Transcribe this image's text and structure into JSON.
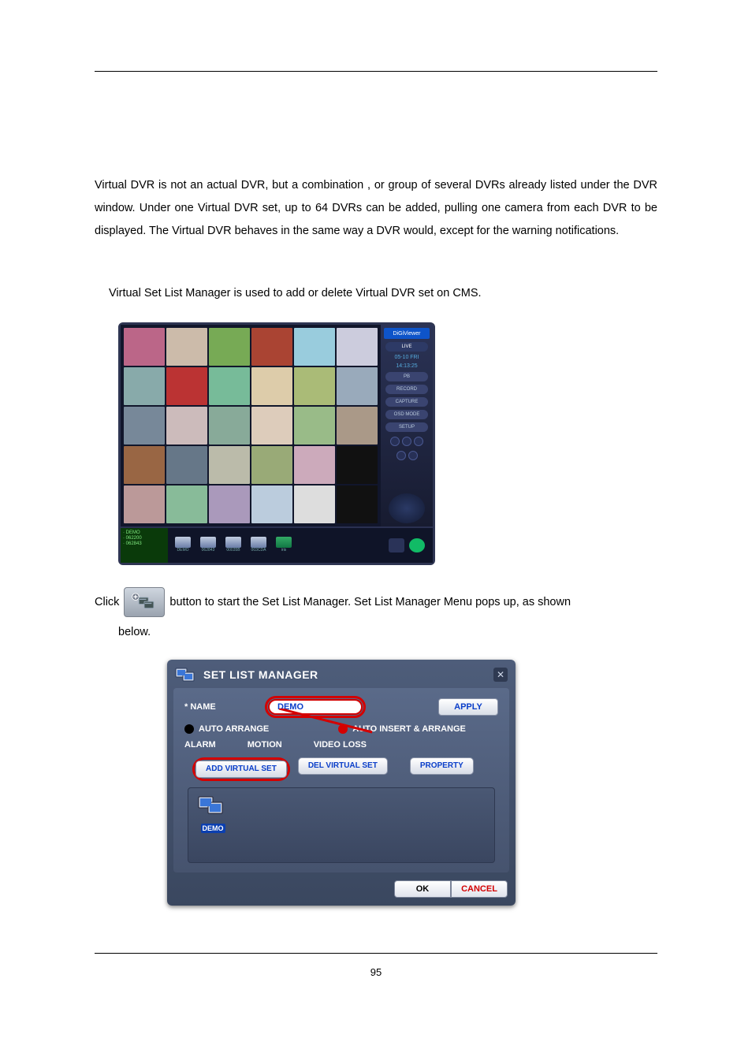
{
  "intro_para": "Virtual DVR is not an actual DVR, but a combination , or group of several DVRs already listed under the DVR window.   Under one Virtual DVR set, up to 64 DVRs can be added, pulling one camera from each DVR to be displayed. The Virtual DVR behaves in the same way a DVR would, except for the warning notifications.",
  "vslm_para": "Virtual Set List Manager is used to add or delete Virtual DVR set on CMS.",
  "click_pre": "Click",
  "click_post": "button to start the Set List Manager. Set List Manager Menu pops up, as shown",
  "below": "below.",
  "page_number": "95",
  "dvr": {
    "logo": "DiGiViewer",
    "live": "LIVE",
    "date": "05-10  FRI",
    "time": "14:13:25",
    "btn_record": "RECORD",
    "btn_capture": "CAPTURE",
    "btn_osd": "OSD MODE",
    "btn_setup": "SETUP",
    "list": [
      "· DEMO",
      "· 062200",
      "· 062843"
    ],
    "thumbs": [
      "DEMO",
      "062843",
      "00035B",
      "003CDA"
    ]
  },
  "dlg": {
    "title": "SET LIST MANAGER",
    "name_label": "* NAME",
    "name_value": "DEMO",
    "apply": "APPLY",
    "auto_arrange": "AUTO ARRANGE",
    "auto_insert": "AUTO INSERT & ARRANGE",
    "alarm": "ALARM",
    "motion": "MOTION",
    "video_loss": "VIDEO LOSS",
    "add": "ADD VIRTUAL SET",
    "del": "DEL VIRTUAL SET",
    "prop": "PROPERTY",
    "item": "DEMO",
    "ok": "OK",
    "cancel": "CANCEL"
  }
}
